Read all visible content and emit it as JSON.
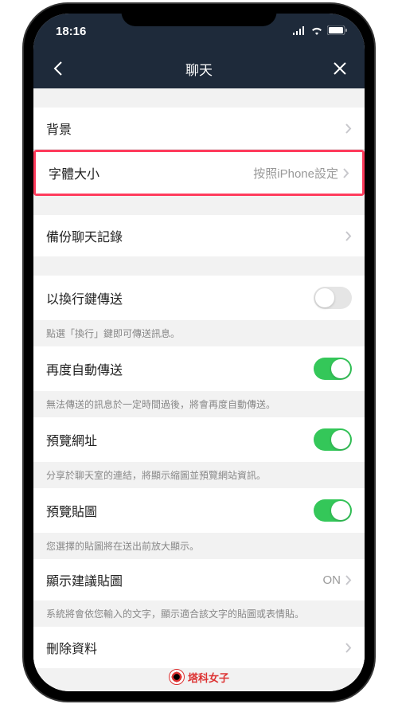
{
  "status": {
    "time": "18:16"
  },
  "nav": {
    "title": "聊天"
  },
  "items": {
    "background": {
      "label": "背景"
    },
    "fontSize": {
      "label": "字體大小",
      "value": "按照iPhone設定"
    },
    "backup": {
      "label": "備份聊天記錄"
    },
    "enterToSend": {
      "label": "以換行鍵傳送",
      "footer": "點選「換行」鍵即可傳送訊息。"
    },
    "autoResend": {
      "label": "再度自動傳送",
      "footer": "無法傳送的訊息於一定時間過後，將會再度自動傳送。"
    },
    "previewUrl": {
      "label": "預覽網址",
      "footer": "分享於聊天室的連結，將顯示縮圖並預覽網站資訊。"
    },
    "previewSticker": {
      "label": "預覽貼圖",
      "footer": "您選擇的貼圖將在送出前放大顯示。"
    },
    "suggestSticker": {
      "label": "顯示建議貼圖",
      "value": "ON",
      "footer": "系統將會依您輸入的文字，顯示適合該文字的貼圖或表情貼。"
    },
    "deleteData": {
      "label": "刪除資料"
    }
  },
  "watermark": {
    "text": "塔科女子"
  }
}
